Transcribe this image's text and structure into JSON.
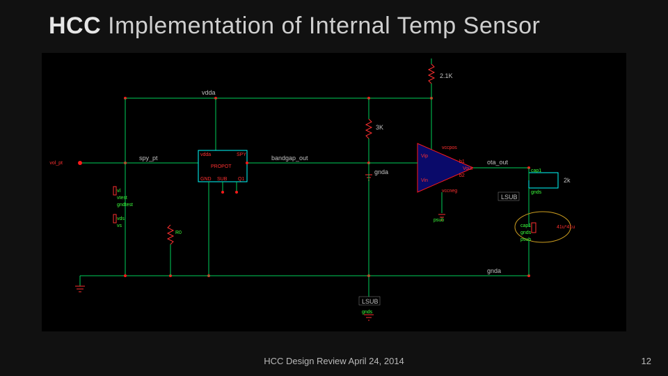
{
  "title": {
    "bold": "HCC",
    "rest": "Implementation of Internal Temp Sensor"
  },
  "footer": "HCC Design Review  April 24, 2014",
  "page": "12",
  "schematic": {
    "power_net": "vdda",
    "ground_net": "gnda",
    "probe": "spy_pt",
    "probe_in": "vol_pt",
    "block": "PROPOT",
    "block_pins": {
      "tl": "vdda",
      "tr": "SPY",
      "bl": "GND",
      "bm": "SUB",
      "br": "Q1"
    },
    "block_out": "bandgap_out",
    "r_top": "3K",
    "r_feedback": "2.1K",
    "r_out": "2k",
    "opamp_out": "ota_out",
    "opamp_pins": {
      "pos": "Vin",
      "neg": "Vip",
      "sup_t": "vccpos",
      "sup_b": "vccneg",
      "out": "Vout",
      "b1": "b1",
      "b2": "b2"
    },
    "sink": "LSUB",
    "sink2": "LSUB",
    "cap_dim": "41u*41u",
    "cap_pins": {
      "a": "cap1",
      "b": "gnds",
      "c": "psub"
    },
    "left_pins": {
      "a": "vl",
      "b": "vtest",
      "c": "gndtest",
      "d": "vds",
      "e": "vs"
    },
    "bot_res": "R0",
    "portsub": "psub"
  }
}
